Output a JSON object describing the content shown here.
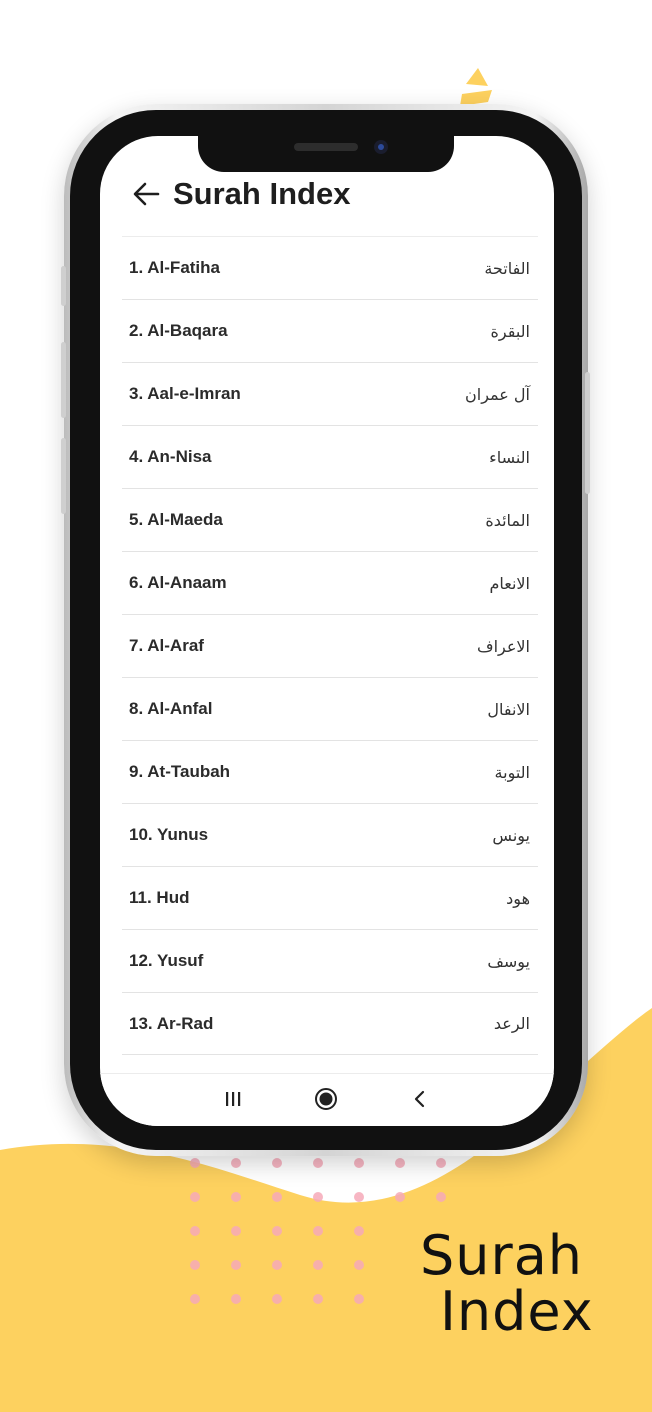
{
  "colors": {
    "accent_yellow": "#fdd15f",
    "dot_pink": "#f6a9b8",
    "text_dark": "#1e1e1e"
  },
  "app": {
    "title": "Surah Index",
    "back_icon": "arrow-left-icon"
  },
  "surahs": [
    {
      "en": "1. Al-Fatiha",
      "ar": "الفاتحة"
    },
    {
      "en": "2. Al-Baqara",
      "ar": "البقرة"
    },
    {
      "en": "3. Aal-e-Imran",
      "ar": "آل عمران"
    },
    {
      "en": "4. An-Nisa",
      "ar": "النساء"
    },
    {
      "en": "5. Al-Maeda",
      "ar": "المائدة"
    },
    {
      "en": "6. Al-Anaam",
      "ar": "الانعام"
    },
    {
      "en": "7. Al-Araf",
      "ar": "الاعراف"
    },
    {
      "en": "8. Al-Anfal",
      "ar": "الانفال"
    },
    {
      "en": "9. At-Taubah",
      "ar": "التوبة"
    },
    {
      "en": "10. Yunus",
      "ar": "يونس"
    },
    {
      "en": "11. Hud",
      "ar": "هود"
    },
    {
      "en": "12. Yusuf",
      "ar": "يوسف"
    },
    {
      "en": "13. Ar-Rad",
      "ar": "الرعد"
    }
  ],
  "navbar": {
    "recents_icon": "recent-apps-icon",
    "home_icon": "home-circle-icon",
    "back_icon": "chevron-left-icon"
  },
  "promo": {
    "line1": "Surah",
    "line2": "Index"
  }
}
